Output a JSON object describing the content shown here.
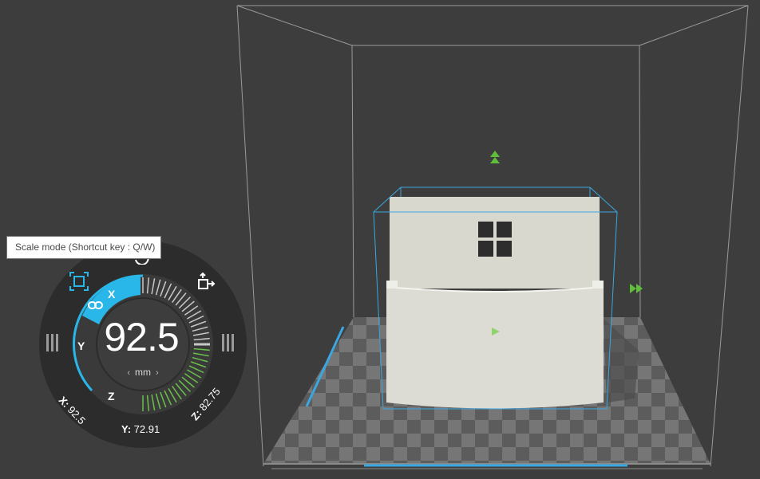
{
  "tooltip": {
    "text": "Scale mode (Shortcut key : Q/W)"
  },
  "dial": {
    "value": "92.5",
    "unit": "mm",
    "prev_symbol": "‹",
    "next_symbol": "›",
    "axes": {
      "x": "X",
      "y": "Y",
      "z": "Z"
    },
    "dimensions": {
      "x_label": "X:",
      "x_value": "92.5",
      "y_label": "Y:",
      "y_value": "72.91",
      "z_label": "Z:",
      "z_value": "82.75"
    }
  },
  "icons": {
    "scale_mode": "scale-mode-icon",
    "move_mode": "move-mode-icon",
    "link": "link-icon",
    "grip": "grip-icon",
    "move_up": "move-up-arrow-icon",
    "move_right": "move-right-arrow-icon"
  },
  "colors": {
    "background": "#3d3d3d",
    "selection_box": "#3aa7e0",
    "axis_x_active": "#29b6e8",
    "ticks_green": "#6bc04b",
    "handle_green": "#5fbf3b",
    "model": "#d9d9d1",
    "build_plate_light": "#7a7a7a",
    "build_plate_dark": "#5f5f5f"
  }
}
